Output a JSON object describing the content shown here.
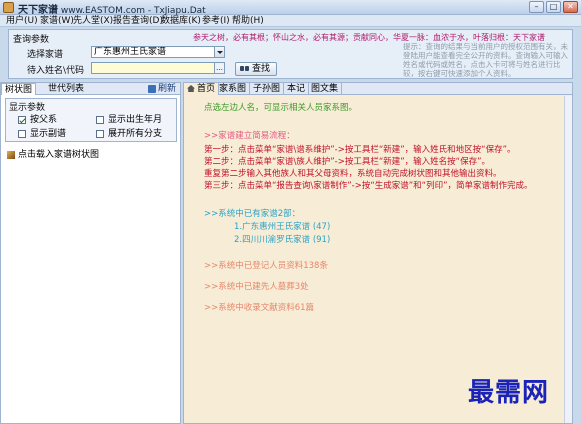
{
  "window": {
    "brand": "天下家谱",
    "title_rest": "www.EASTOM.com - TxJiapu.Dat",
    "buttons": [
      "–",
      "□",
      "✕"
    ]
  },
  "menu": [
    "用户(U)",
    "家谱(W)",
    "先人堂(X)",
    "报告查询(D)",
    "数据库(K)",
    "参考(I)",
    "帮助(H)"
  ],
  "query": {
    "section_title": "查询参数",
    "slogan": "参天之树，必有其根；怀山之水，必有其源；贡献同心，华夏一脉：血浓于水，叶落归根：天下家谱",
    "label_select": "选择家谱",
    "selected_tree": "广东惠州王氏家谱",
    "label_name": "待入姓名\\代码",
    "name_value": "",
    "search_button": "查找",
    "tip": "提示：查询的结果与当前用户的授权范围有关，未登陆用户能查看完全公开的资料。查询输入可输入姓名或代码或姓名，点击入卡可将与姓名进行比较，按右键可快速添加个人资料。"
  },
  "left": {
    "tabs": [
      "树状图",
      "世代列表"
    ],
    "refresh": "刷新",
    "group_title": "显示参数",
    "checkboxes": [
      {
        "label": "按父系",
        "checked": true
      },
      {
        "label": "显示出生年月",
        "checked": false
      },
      {
        "label": "显示副谱",
        "checked": false
      },
      {
        "label": "展开所有分支",
        "checked": false
      }
    ],
    "tree_item": "点击载入家谱树状图"
  },
  "right": {
    "tabs": [
      "首页",
      "家系图",
      "子孙图",
      "本记",
      "图文集"
    ],
    "content": {
      "hint": "点选左边人名，可显示相关人员家系图。",
      "steps_title": ">>家谱建立简易流程：",
      "steps": [
        "第一步：点击菜单“家谱\\谱系维护”->按工具栏“新建”，输入姓氏和地区按“保存”。",
        "第二步：点击菜单“家谱\\族人维护”->按工具栏“新建”，输入姓名按“保存”。",
        "重复第二步输入其他族人和其父母资料，系统自动完成树状图和其他输出资料。",
        "第三步：点击菜单“报告查询\\家谱制作”->按“生成家谱”和“列印”，简单家谱制作完成。"
      ],
      "trees_title": ">>系统中已有家谱2部：",
      "trees": [
        "1.广东惠州王氏家谱 (47)",
        "2.四川川渝罗氏家谱 (91)"
      ],
      "stats": [
        ">>系统中已登记人员资料138条",
        ">>系统中已建先人墓葬3处",
        ">>系统中收录文献资料61篇"
      ]
    }
  },
  "watermark": "最需网",
  "colors": {
    "green": "#3c9b2a",
    "pink": "#e25b84",
    "red": "#c0132b",
    "blue": "#2aa3c8",
    "salmon": "#e6876d",
    "watermark": "#1a22b8"
  }
}
